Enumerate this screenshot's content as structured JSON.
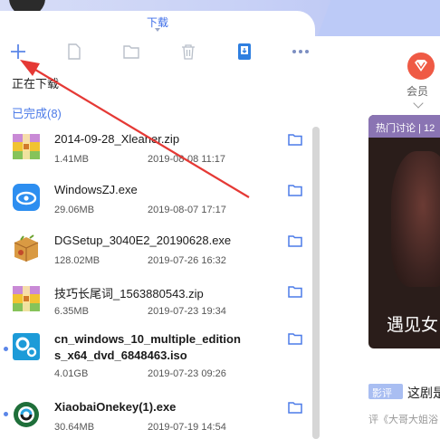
{
  "header": {
    "tab_label": "下载"
  },
  "toolbar": {
    "buttons": [
      {
        "icon": "plus-icon"
      },
      {
        "icon": "file-icon"
      },
      {
        "icon": "folder-icon"
      },
      {
        "icon": "trash-icon"
      },
      {
        "icon": "phone-icon"
      },
      {
        "icon": "more-icon"
      }
    ]
  },
  "sections": {
    "downloading": "正在下载",
    "completed": "已完成(8)"
  },
  "files": [
    {
      "name": "2014-09-28_Xleaner.zip",
      "size": "1.41MB",
      "date": "2019-08-08 11:17",
      "icon": "archive-icon"
    },
    {
      "name": "WindowsZJ.exe",
      "size": "29.06MB",
      "date": "2019-08-07 17:17",
      "icon": "exe-app-icon"
    },
    {
      "name": "DGSetup_3040E2_20190628.exe",
      "size": "128.02MB",
      "date": "2019-07-26 16:32",
      "icon": "setup-package-icon"
    },
    {
      "name": "技巧长尾词_1563880543.zip",
      "size": "6.35MB",
      "date": "2019-07-23 19:34",
      "icon": "archive-icon"
    },
    {
      "name": "cn_windows_10_multiple_editions_x64_dvd_6848463.iso",
      "name_line1": "cn_windows_10_multiple_edition",
      "name_line2": "s_x64_dvd_6848463.iso",
      "size": "4.01GB",
      "date": "2019-07-23 09:26",
      "icon": "iso-gear-icon"
    },
    {
      "name": "XiaobaiOnekey(1).exe",
      "size": "30.64MB",
      "date": "2019-07-19 14:54",
      "icon": "xiaobai-app-icon"
    }
  ],
  "right_panel": {
    "vip_label": "会员",
    "hot_header": "热门讨论 | 12",
    "card_title": "遇见女",
    "review_badge": "影评",
    "review_text": "这剧是",
    "review_sub": "评《大哥大姐浴"
  },
  "colors": {
    "accent": "#4c7be8",
    "annotation_red": "#e53935"
  }
}
